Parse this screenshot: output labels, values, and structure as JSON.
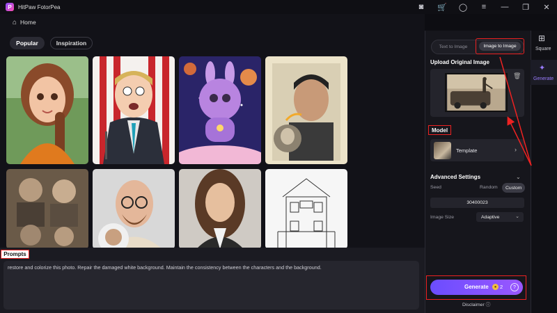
{
  "app": {
    "title": "HitPaw FotorPea",
    "logo_letter": "P"
  },
  "titlebar_icons": [
    "discord-icon",
    "gift-icon",
    "account-icon",
    "menu-icon",
    "minimize-icon",
    "restore-icon",
    "close-icon"
  ],
  "titlebar_glyphs": [
    "◙",
    "🛒",
    "◯",
    "≡",
    "—",
    "❐",
    "✕"
  ],
  "breadcrumb": {
    "home_label": "Home"
  },
  "gallery": {
    "tabs": [
      {
        "label": "Popular"
      },
      {
        "label": "Inspiration"
      }
    ],
    "items": [
      {
        "name": "animated-girl-braid"
      },
      {
        "name": "cartoon-man-suit"
      },
      {
        "name": "purple-bunny-astronaut"
      },
      {
        "name": "restored-vintage-portrait"
      },
      {
        "name": "old-family-photo"
      },
      {
        "name": "bald-man-glasses"
      },
      {
        "name": "woman-portrait"
      },
      {
        "name": "house-line-sketch"
      }
    ]
  },
  "prompts": {
    "label": "Prompts",
    "text": "restore and colorize this photo. Repair the damaged white background. Maintain the consistency between the characters and the background."
  },
  "panel": {
    "mode_tabs": {
      "text_to_image": "Text to Image",
      "image_to_image": "Image to Image",
      "active": "Image to Image"
    },
    "upload_title": "Upload Original Image",
    "model_label": "Model",
    "model_name": "Template",
    "advanced_title": "Advanced Settings",
    "seed_label": "Seed",
    "seed_random": "Random",
    "seed_custom": "Custom",
    "seed_value": "30400023",
    "image_size_label": "Image Size",
    "image_size_value": "Adaptive",
    "generate_label": "Generate",
    "generate_cost": "2",
    "disclaimer": "Disclaimer"
  },
  "rightnav": {
    "square_label": "Square",
    "generate_label": "Generate"
  },
  "colors": {
    "accent": "#7b55ff",
    "highlight": "#e22222"
  }
}
